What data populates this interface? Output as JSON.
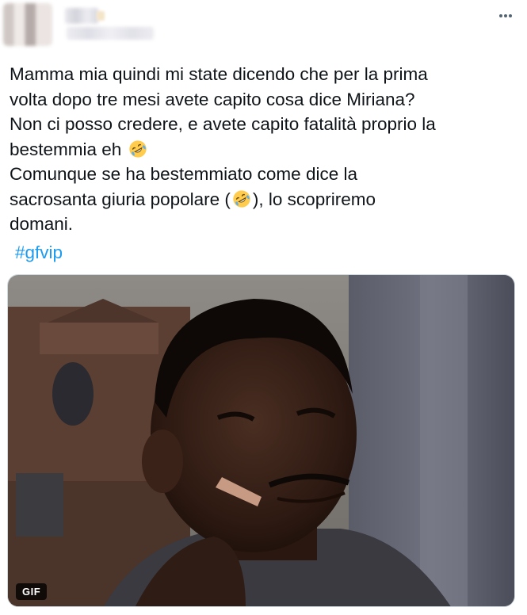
{
  "header": {
    "more_icon": "more-horizontal-icon"
  },
  "tweet": {
    "lines": [
      "Mamma mia quindi mi state dicendo che per la prima",
      "volta dopo tre mesi avete capito cosa dice Miriana?",
      "Non ci posso credere, e avete capito fatalità proprio la",
      "bestemmia eh ",
      "Comunque se ha bestemmiato come dice la",
      "sacrosanta giuria  popolare (",
      "), lo scopriremo",
      "domani."
    ],
    "emoji": "rolling-on-the-floor-laughing-emoji",
    "hashtag": "#gfvip"
  },
  "media": {
    "badge": "GIF",
    "description_icon": "gif-media"
  },
  "colors": {
    "text": "#0f1419",
    "link": "#1d9bf0",
    "border": "#cfd9de",
    "muted": "#536471"
  }
}
